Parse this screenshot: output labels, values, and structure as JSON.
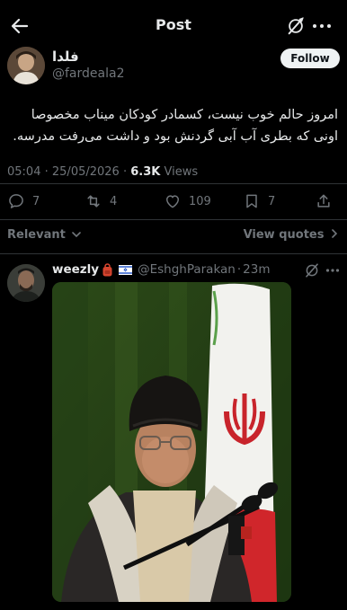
{
  "header": {
    "title": "Post",
    "back_icon": "arrow-left-icon",
    "grok_icon": "grok-icon",
    "more_icon": "more-horizontal-icon"
  },
  "tweet": {
    "author_name": "فلدا",
    "author_handle": "@fardeala2",
    "follow_label": "Follow",
    "text_line1": "امروز حالم خوب نیست، کسمادر کودکان میناب مخصوصا",
    "text_line2": "اونی که بطری آب آبی گردنش بود و داشت می‌رفت مدرسه.",
    "time": "05:04",
    "date": "25/05/2026",
    "views_count": "6.3K",
    "views_label": "Views",
    "replies": "7",
    "reposts": "4",
    "likes": "109",
    "bookmarks": "7"
  },
  "filters": {
    "sort_label": "Relevant",
    "view_quotes": "View quotes"
  },
  "reply": {
    "name": "weezly",
    "handle": "@EshghParakan",
    "time": "23m"
  },
  "colors": {
    "background": "#000000",
    "text_primary": "#e7e9ea",
    "text_secondary": "#71767b",
    "divider": "#2f3336",
    "follow_bg": "#eff3f4"
  }
}
